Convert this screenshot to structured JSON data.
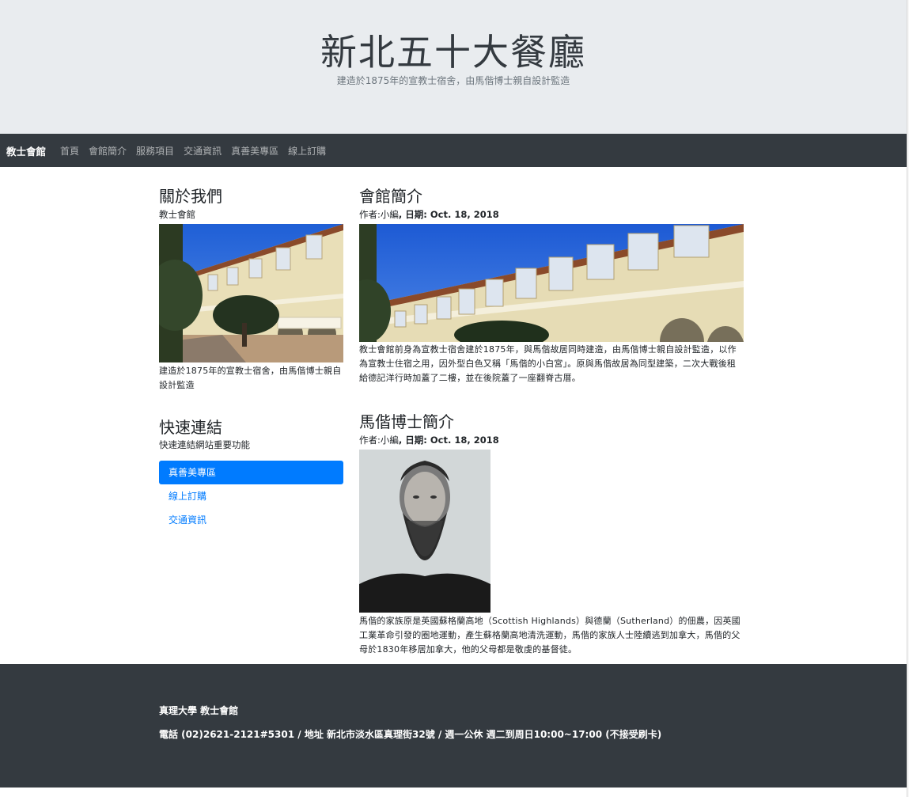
{
  "header": {
    "title": "新北五十大餐廳",
    "subtitle": "建造於1875年的宣教士宿舍，由馬偕博士親自設計監造"
  },
  "navbar": {
    "brand": "教士會館",
    "links": [
      "首頁",
      "會館簡介",
      "服務項目",
      "交通資訊",
      "真善美專區",
      "線上訂購"
    ]
  },
  "about": {
    "heading": "關於我們",
    "subheading": "教士會館",
    "caption": "建造於1875年的宣教士宿舍，由馬偕博士親自設計監造"
  },
  "quick_links": {
    "heading": "快速連結",
    "subheading": "快速連結網站重要功能",
    "items": [
      {
        "label": "真善美專區",
        "active": true
      },
      {
        "label": "線上訂購",
        "active": false
      },
      {
        "label": "交通資訊",
        "active": false
      }
    ]
  },
  "article1": {
    "title": "會館簡介",
    "author_prefix": "作者:",
    "author": "小編",
    "date_prefix": ", 日期: ",
    "date": "Oct. 18, 2018",
    "body": "教士會館前身為宣教士宿舍建於1875年，與馬偕故居同時建造，由馬偕博士親自設計監造，以作為宣教士住宿之用，因外型白色又稱「馬偕的小白宮」。原與馬偕故居為同型建築，二次大戰後租給德記洋行時加蓋了二樓，並在後院蓋了一座翻脊古厝。"
  },
  "article2": {
    "title": "馬偕博士簡介",
    "author_prefix": "作者:",
    "author": "小編",
    "date_prefix": ", 日期: ",
    "date": "Oct. 18, 2018",
    "body": "馬偕的家族原是英國蘇格蘭高地（Scottish Highlands）與德蘭（Sutherland）的佃農，因英國工業革命引發的圈地運動，產生蘇格蘭高地清洗運動，馬偕的家族人士陸續逃到加拿大，馬偕的父母於1830年移居加拿大，他的父母都是敬虔的基督徒。"
  },
  "footer": {
    "line1": "真理大學 教士會館",
    "line2": "電話 (02)2621-2121#5301 / 地址 新北市淡水區真理街32號 / 週一公休 週二到周日10:00~17:00 (不接受刷卡)"
  },
  "colors": {
    "jumbotron_bg": "#e9ecef",
    "navbar_bg": "#343a40",
    "primary": "#007bff"
  }
}
